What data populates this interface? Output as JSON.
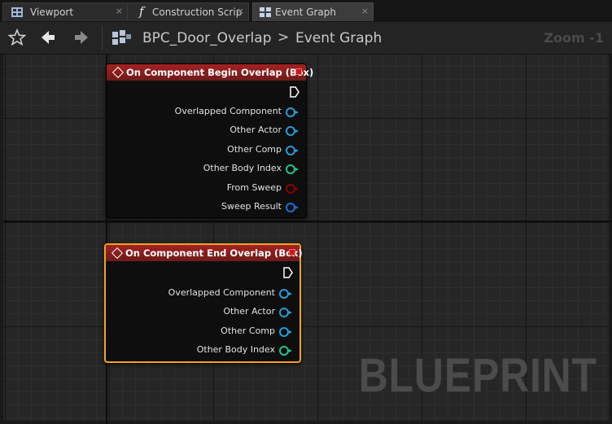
{
  "tabs": [
    {
      "label": "Viewport",
      "icon": "viewport-icon"
    },
    {
      "label": "Construction Scrip",
      "icon": "function-icon"
    },
    {
      "label": "Event Graph",
      "icon": "graph-icon"
    }
  ],
  "tab_close_glyph": "×",
  "breadcrumb": {
    "blueprint": "BPC_Door_Overlap",
    "separator": ">",
    "graph": "Event Graph"
  },
  "zoom_label": "Zoom -1",
  "watermark": "BLUEPRINT",
  "nodes": [
    {
      "title": "On Component Begin Overlap (Box)",
      "selected": false,
      "pins": [
        {
          "label": "Overlapped Component",
          "color": "#2a9bd8"
        },
        {
          "label": "Other Actor",
          "color": "#2a9bd8"
        },
        {
          "label": "Other Comp",
          "color": "#2a9bd8"
        },
        {
          "label": "Other Body Index",
          "color": "#21c48a"
        },
        {
          "label": "From Sweep",
          "color": "#8c0000"
        },
        {
          "label": "Sweep Result",
          "color": "#1d6fd6"
        }
      ]
    },
    {
      "title": "On Component End Overlap (Box)",
      "selected": true,
      "pins": [
        {
          "label": "Overlapped Component",
          "color": "#2a9bd8"
        },
        {
          "label": "Other Actor",
          "color": "#2a9bd8"
        },
        {
          "label": "Other Comp",
          "color": "#2a9bd8"
        },
        {
          "label": "Other Body Index",
          "color": "#21c48a"
        }
      ]
    }
  ],
  "colors": {
    "event_header": "#a32222",
    "selection": "#f0a321",
    "graph_bg": "#262626"
  }
}
